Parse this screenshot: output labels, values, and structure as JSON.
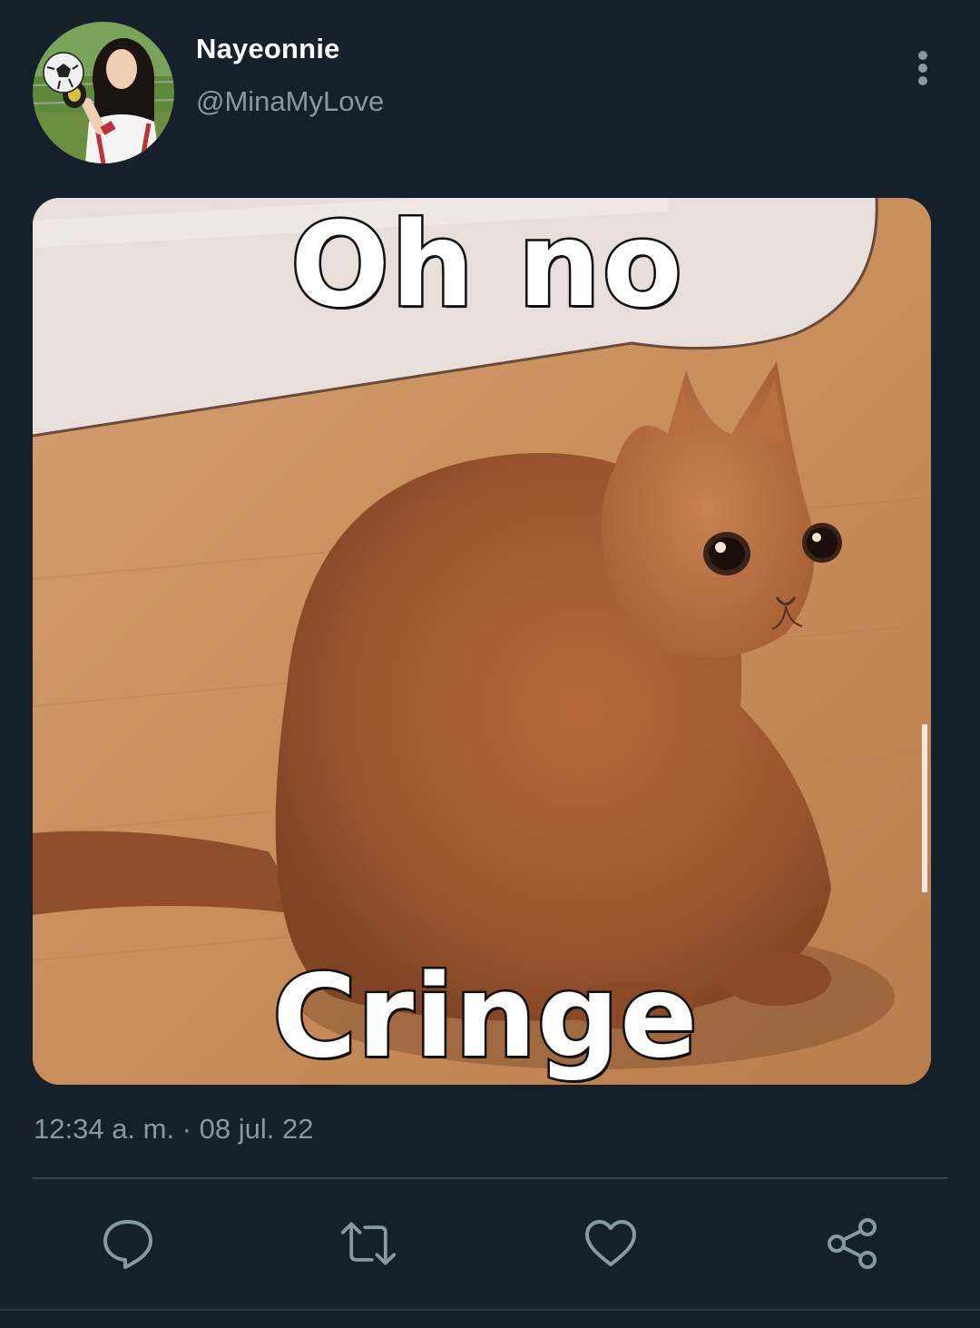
{
  "author": {
    "display_name": "Nayeonnie",
    "handle": "@MinaMyLove"
  },
  "media": {
    "caption_top": "Oh no",
    "caption_bottom": "Cringe"
  },
  "tweet": {
    "timestamp": "12:34 a. m. · 08 jul. 22"
  },
  "actions": [
    {
      "name": "reply",
      "icon": "comment-icon"
    },
    {
      "name": "retweet",
      "icon": "retweet-icon"
    },
    {
      "name": "like",
      "icon": "heart-icon"
    },
    {
      "name": "share",
      "icon": "share-icon"
    }
  ],
  "colors": {
    "background": "#15202b",
    "secondary_text": "#8899a6",
    "divider": "#38444d",
    "icon": "#8899a6"
  }
}
